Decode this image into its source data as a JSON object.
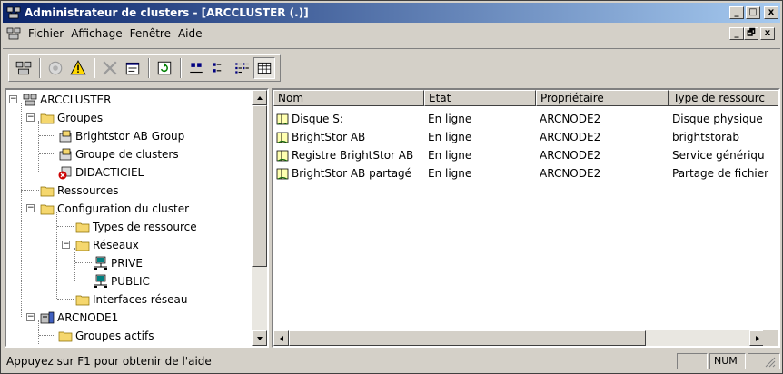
{
  "window": {
    "title": "Administrateur de clusters - [ARCCLUSTER (.)]",
    "caption_min": "_",
    "caption_max": "□",
    "caption_close": "x",
    "mdi_min": "_",
    "mdi_restore": "🗗",
    "mdi_close": "x"
  },
  "menu": [
    "Fichier",
    "Affichage",
    "Fenêtre",
    "Aide"
  ],
  "toolbar": {
    "buttons": [
      "connect-cluster-icon",
      "node-online-icon",
      "warning-icon",
      "delete-icon",
      "properties-icon",
      "refresh-icon",
      "large-icons-icon",
      "small-icons-icon",
      "list-icon",
      "details-icon"
    ],
    "pressed": "details-icon"
  },
  "tree": {
    "root": "ARCCLUSTER",
    "groups": "Groupes",
    "group_brightstor": "Brightstor AB Group",
    "group_cluster": "Groupe de clusters",
    "group_didacticiel": "DIDACTICIEL",
    "resources": "Ressources",
    "cluster_config": "Configuration du cluster",
    "resource_types": "Types de ressource",
    "networks": "Réseaux",
    "net_prive": "PRIVE",
    "net_public": "PUBLIC",
    "net_interfaces": "Interfaces réseau",
    "node1": "ARCNODE1",
    "active_groups": "Groupes actifs"
  },
  "list": {
    "columns": [
      "Nom",
      "Etat",
      "Propriétaire",
      "Type de ressourc"
    ],
    "rows": [
      {
        "nom": "Disque S:",
        "etat": "En ligne",
        "proprietaire": "ARCNODE2",
        "type": "Disque physique"
      },
      {
        "nom": "BrightStor AB",
        "etat": "En ligne",
        "proprietaire": "ARCNODE2",
        "type": "brightstorab"
      },
      {
        "nom": "Registre BrightStor AB",
        "etat": "En ligne",
        "proprietaire": "ARCNODE2",
        "type": "Service génériqu"
      },
      {
        "nom": "BrightStor AB partagé",
        "etat": "En ligne",
        "proprietaire": "ARCNODE2",
        "type": "Partage de fichier"
      }
    ]
  },
  "status": {
    "text": "Appuyez sur F1 pour obtenir de l'aide",
    "num": "NUM"
  },
  "colors": {
    "title_start": "#0a246a",
    "title_end": "#a6caf0",
    "face": "#d4d0c8",
    "folder": "#f5d76e",
    "error_red": "#cc0000"
  }
}
